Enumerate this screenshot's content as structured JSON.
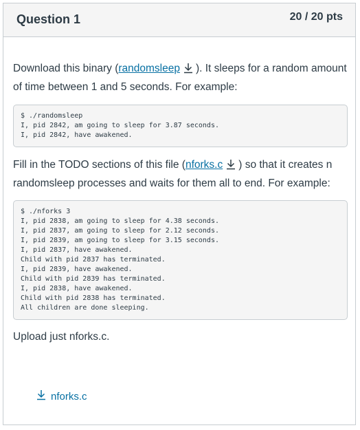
{
  "question": {
    "title": "Question 1",
    "points": "20 / 20 pts"
  },
  "body": {
    "p1": {
      "before": "Download this binary (",
      "link": "randomsleep",
      "after": "). It sleeps for a random amount of time between 1 and 5 seconds.  For example:"
    },
    "code1": "$ ./randomsleep\nI, pid 2842, am going to sleep for 3.87 seconds.\nI, pid 2842, have awakened.",
    "p2": {
      "before": "Fill in the TODO sections of this file (",
      "link": "nforks.c",
      "after": ") so that it creates n randomsleep processes and waits for them all to end.  For example:"
    },
    "code2": "$ ./nforks 3\nI, pid 2838, am going to sleep for 4.38 seconds.\nI, pid 2837, am going to sleep for 2.12 seconds.\nI, pid 2839, am going to sleep for 3.15 seconds.\nI, pid 2837, have awakened.\nChild with pid 2837 has terminated.\nI, pid 2839, have awakened.\nChild with pid 2839 has terminated.\nI, pid 2838, have awakened.\nChild with pid 2838 has terminated.\nAll children are done sleeping.",
    "p3": "Upload just nforks.c."
  },
  "submission": {
    "file_name": "nforks.c",
    "icon": "download-icon"
  },
  "colors": {
    "link": "#0770a3",
    "text": "#2d3b45",
    "header_bg": "#f5f5f5",
    "border": "#c7cdd1"
  }
}
